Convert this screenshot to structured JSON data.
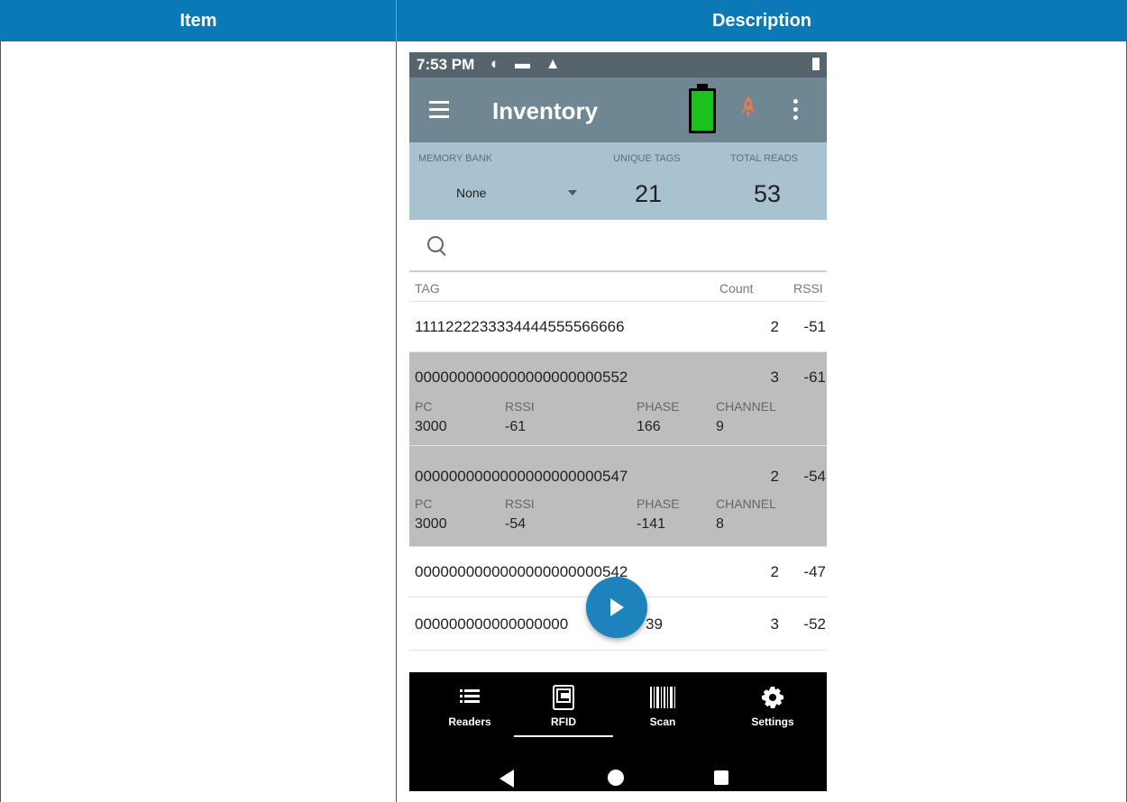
{
  "table": {
    "header_item": "Item",
    "header_description": "Description"
  },
  "phone": {
    "status": {
      "time": "7:53 PM"
    },
    "appbar": {
      "title": "Inventory"
    },
    "summary": {
      "memory_bank_label": "MEMORY BANK",
      "memory_bank_value": "None",
      "unique_tags_label": "UNIQUE TAGS",
      "unique_tags_value": "21",
      "total_reads_label": "TOTAL READS",
      "total_reads_value": "53"
    },
    "list_header": {
      "tag": "TAG",
      "count": "Count",
      "rssi": "RSSI"
    },
    "tags": [
      {
        "id": "1111222233334444555566666",
        "count": "2",
        "rssi": "-51"
      },
      {
        "id": "0000000000000000000000552",
        "count": "3",
        "rssi": "-61",
        "details": {
          "pc_label": "PC",
          "pc": "3000",
          "rssi_label": "RSSI",
          "rssi": "-61",
          "phase_label": "PHASE",
          "phase": "166",
          "channel_label": "CHANNEL",
          "channel": "9"
        }
      },
      {
        "id": "0000000000000000000000547",
        "count": "2",
        "rssi": "-54",
        "details": {
          "pc_label": "PC",
          "pc": "3000",
          "rssi_label": "RSSI",
          "rssi": "-54",
          "phase_label": "PHASE",
          "phase": "-141",
          "channel_label": "CHANNEL",
          "channel": "8"
        }
      },
      {
        "id": "0000000000000000000000542",
        "count": "2",
        "rssi": "-47"
      },
      {
        "id": "000000000000000000",
        "id_tail": "39",
        "count": "3",
        "rssi": "-52"
      }
    ],
    "bottom_nav": [
      {
        "label": "Readers"
      },
      {
        "label": "RFID"
      },
      {
        "label": "Scan"
      },
      {
        "label": "Settings"
      }
    ],
    "colors": {
      "header_blue": "#0a79b5",
      "status_bar": "#56646d",
      "app_bar": "#6f8793",
      "summary_bg": "#a9c2cf",
      "expanded_row": "#bdbdbd",
      "fab": "#1e82bd",
      "battery_green": "#1cc21c",
      "alert_orange": "#f07a4a"
    }
  }
}
